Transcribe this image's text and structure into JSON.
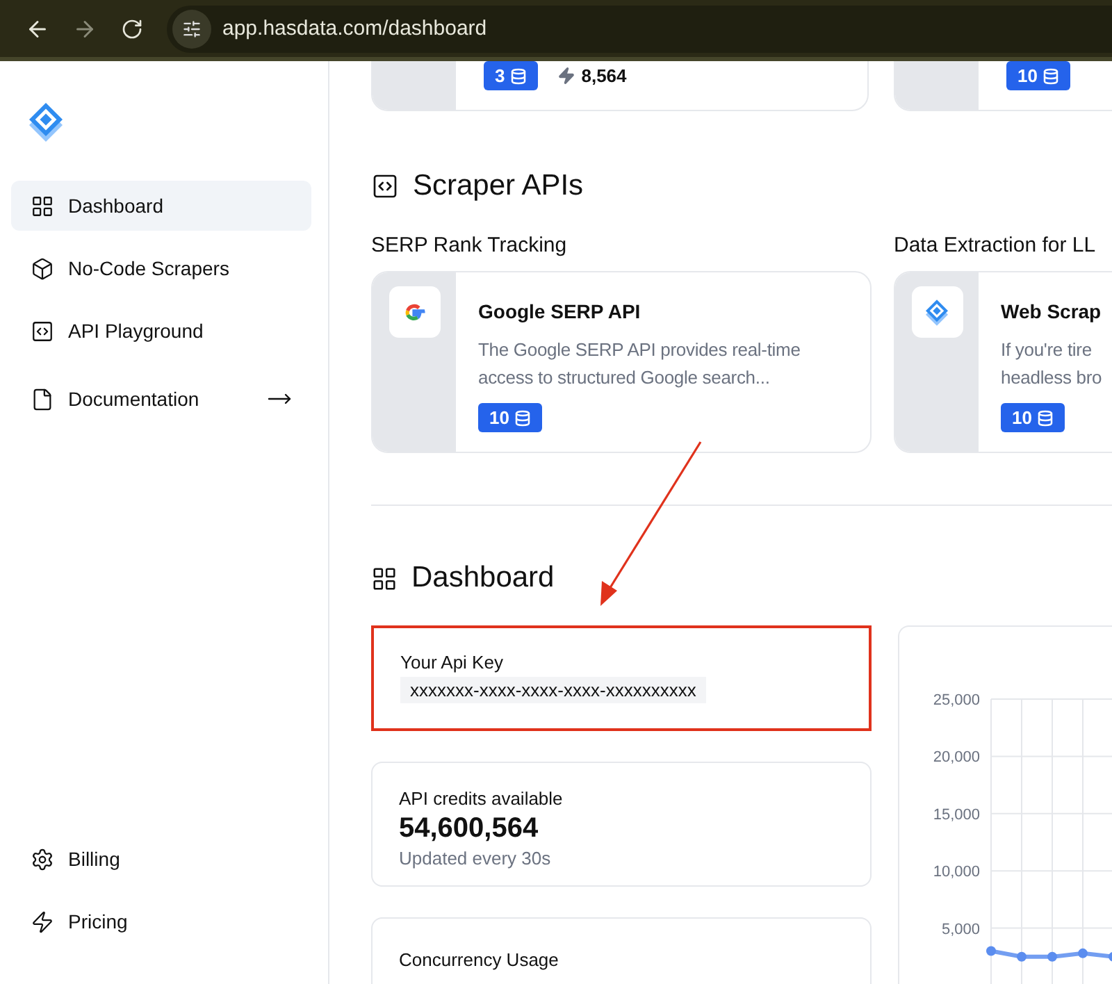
{
  "browser": {
    "url": "app.hasdata.com/dashboard"
  },
  "sidebar": {
    "items": [
      {
        "label": "Dashboard",
        "selected": true,
        "external": false
      },
      {
        "label": "No-Code Scrapers",
        "selected": false,
        "external": false
      },
      {
        "label": "API Playground",
        "selected": false,
        "external": false
      },
      {
        "label": "Documentation",
        "selected": false,
        "external": true
      }
    ],
    "bottom_items": [
      {
        "label": "Billing",
        "selected": false
      },
      {
        "label": "Pricing",
        "selected": false
      }
    ]
  },
  "top_cards": [
    {
      "credits": "3",
      "requests": "8,564"
    },
    {
      "credits": "10"
    }
  ],
  "scraper_apis": {
    "title": "Scraper APIs",
    "groups": [
      {
        "title": "SERP Rank Tracking",
        "card": {
          "name": "Google SERP API",
          "description_lines": [
            "The Google SERP API provides real-time",
            "access to structured Google search..."
          ],
          "credits": "10"
        }
      },
      {
        "title": "Data Extraction for LL",
        "card": {
          "name": "Web Scrap",
          "description_lines": [
            "If you're tire",
            "headless bro"
          ],
          "credits": "10"
        }
      }
    ]
  },
  "dashboard": {
    "title": "Dashboard",
    "api_key": {
      "label": "Your Api Key",
      "value": "xxxxxxx-xxxx-xxxx-xxxx-xxxxxxxxxx",
      "highlighted": true
    },
    "credits": {
      "label": "API credits available",
      "value": "54,600,564",
      "note": "Updated every 30s"
    },
    "concurrency": {
      "label": "Concurrency Usage"
    },
    "chart": {
      "chart_data": {
        "type": "line",
        "grid": true,
        "ylim": [
          0,
          25000
        ],
        "yticks": [
          {
            "value": 5000,
            "label": "5,000"
          },
          {
            "value": 10000,
            "label": "10,000"
          },
          {
            "value": 15000,
            "label": "15,000"
          },
          {
            "value": 20000,
            "label": "20,000"
          },
          {
            "value": 25000,
            "label": "25,000"
          }
        ],
        "series": [
          {
            "color": "#5b8def",
            "marker": true,
            "values": [
              3000,
              2500,
              2500,
              2800,
              2500
            ]
          }
        ]
      }
    }
  }
}
